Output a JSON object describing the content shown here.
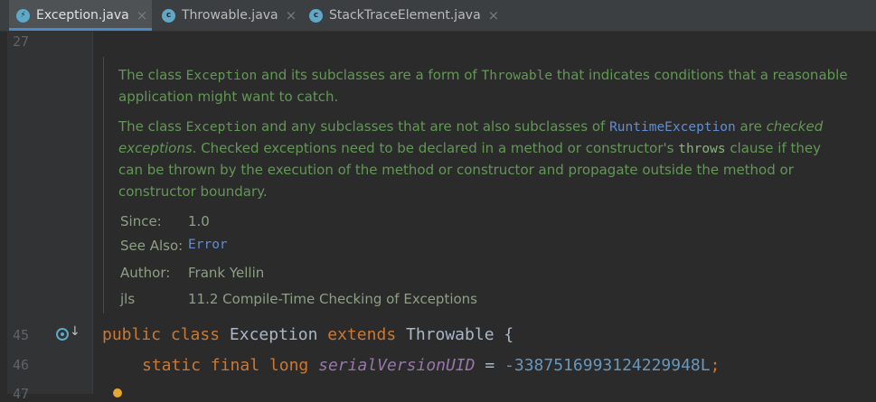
{
  "tabs": [
    {
      "label": "Exception.java",
      "active": true,
      "icon": "java-interface-icon",
      "icon_color": "#5fa8c8"
    },
    {
      "label": "Throwable.java",
      "active": false,
      "icon": "java-class-icon",
      "icon_color": "#5fa8c8"
    },
    {
      "label": "StackTraceElement.java",
      "active": false,
      "icon": "java-class-icon",
      "icon_color": "#5fa8c8"
    }
  ],
  "close_glyph": "×",
  "gutter": {
    "lines": [
      "27",
      "45",
      "46",
      "47"
    ]
  },
  "doc": {
    "p1": {
      "a": "The class ",
      "code1": "Exception",
      "b": " and its subclasses are a form of ",
      "code2": "Throwable",
      "c": " that indicates conditions that a reasonable",
      "line2": "application might want to catch."
    },
    "p2": {
      "a": "The class ",
      "code1": "Exception",
      "b": " and any subclasses that are not also subclasses of ",
      "link1": "RuntimeException",
      "c": " are ",
      "em1": "checked",
      "em2": "exceptions",
      "d": ". Checked exceptions need to be declared in a method or constructor's ",
      "code2": "throws",
      "e": " clause if they",
      "line3": "can be thrown by the execution of the method or constructor and propagate outside the method or",
      "line4": "constructor boundary."
    },
    "meta": [
      {
        "label": "Since:",
        "value": "1.0",
        "link": false
      },
      {
        "label": "See Also:",
        "value": "Error",
        "link": true
      },
      {
        "label": "Author:",
        "value": "Frank Yellin",
        "link": false
      },
      {
        "label": "jls",
        "value": "11.2 Compile-Time Checking of Exceptions",
        "link": false
      }
    ]
  },
  "code": {
    "line45": {
      "kw1": "public",
      "kw2": "class",
      "name": "Exception",
      "kw3": "extends",
      "parent": "Throwable",
      "brace": "{"
    },
    "line46": {
      "kw1": "static",
      "kw2": "final",
      "kw3": "long",
      "field": "serialVersionUID",
      "eq": "=",
      "value": "-3387516993124229948L",
      "semi": ";"
    }
  },
  "colors": {
    "background": "#2b2b2b",
    "keyword": "#cc7832",
    "doc_text": "#629755",
    "link": "#5f8dd3",
    "number": "#6897bb",
    "field": "#9876aa"
  }
}
